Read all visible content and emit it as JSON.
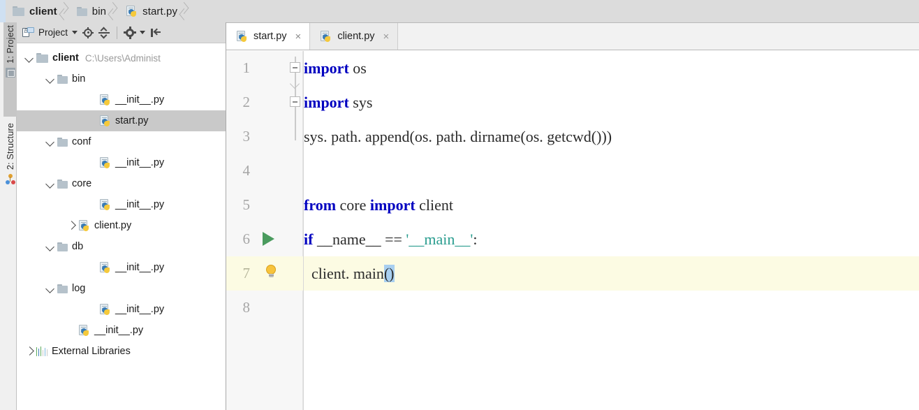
{
  "breadcrumb": {
    "items": [
      {
        "label": "client",
        "icon": "folder-icon",
        "bold": true
      },
      {
        "label": "bin",
        "icon": "folder-icon",
        "bold": false
      },
      {
        "label": "start.py",
        "icon": "python-file-icon",
        "bold": false
      }
    ]
  },
  "tool_strip": {
    "tabs": [
      {
        "label": "1: Project",
        "icon": "project-window-icon",
        "active": true
      },
      {
        "label": "2: Structure",
        "icon": "structure-window-icon",
        "active": false
      }
    ]
  },
  "project_panel": {
    "toolbar": {
      "view_label": "Project",
      "view_icon": "project-view-icon",
      "dropdown_icon": "chevron-down-icon",
      "locate_icon": "scroll-from-source-icon",
      "collapse_icon": "collapse-all-icon",
      "settings_icon": "gear-icon",
      "settings_dropdown_icon": "chevron-down-icon",
      "hide_icon": "hide-panel-icon"
    },
    "tree": [
      {
        "label": "client",
        "path": "C:\\Users\\Administ",
        "icon": "folder-icon",
        "twisty": "down",
        "indent": 0,
        "bold": true,
        "selected": false
      },
      {
        "label": "bin",
        "path": "",
        "icon": "folder-icon",
        "twisty": "down",
        "indent": 1,
        "bold": false,
        "selected": false
      },
      {
        "label": "__init__.py",
        "path": "",
        "icon": "python-file-icon",
        "twisty": "none",
        "indent": 3,
        "bold": false,
        "selected": false
      },
      {
        "label": "start.py",
        "path": "",
        "icon": "python-file-icon",
        "twisty": "none",
        "indent": 3,
        "bold": false,
        "selected": true
      },
      {
        "label": "conf",
        "path": "",
        "icon": "folder-icon",
        "twisty": "down",
        "indent": 1,
        "bold": false,
        "selected": false
      },
      {
        "label": "__init__.py",
        "path": "",
        "icon": "python-file-icon",
        "twisty": "none",
        "indent": 3,
        "bold": false,
        "selected": false
      },
      {
        "label": "core",
        "path": "",
        "icon": "folder-icon",
        "twisty": "down",
        "indent": 1,
        "bold": false,
        "selected": false
      },
      {
        "label": "__init__.py",
        "path": "",
        "icon": "python-file-icon",
        "twisty": "none",
        "indent": 3,
        "bold": false,
        "selected": false
      },
      {
        "label": "client.py",
        "path": "",
        "icon": "python-file-icon",
        "twisty": "right",
        "indent": 2,
        "bold": false,
        "selected": false
      },
      {
        "label": "db",
        "path": "",
        "icon": "folder-icon",
        "twisty": "down",
        "indent": 1,
        "bold": false,
        "selected": false
      },
      {
        "label": "__init__.py",
        "path": "",
        "icon": "python-file-icon",
        "twisty": "none",
        "indent": 3,
        "bold": false,
        "selected": false
      },
      {
        "label": "log",
        "path": "",
        "icon": "folder-icon",
        "twisty": "down",
        "indent": 1,
        "bold": false,
        "selected": false
      },
      {
        "label": "__init__.py",
        "path": "",
        "icon": "python-file-icon",
        "twisty": "none",
        "indent": 3,
        "bold": false,
        "selected": false
      },
      {
        "label": "__init__.py",
        "path": "",
        "icon": "python-file-icon",
        "twisty": "none",
        "indent": 2,
        "bold": false,
        "selected": false
      },
      {
        "label": "External Libraries",
        "path": "",
        "icon": "library-icon",
        "twisty": "right",
        "indent": 0,
        "bold": false,
        "selected": false
      }
    ]
  },
  "editor": {
    "tabs": [
      {
        "label": "start.py",
        "icon": "python-file-icon",
        "close_icon": "close-icon",
        "active": true
      },
      {
        "label": "client.py",
        "icon": "python-file-icon",
        "close_icon": "close-icon",
        "active": false
      }
    ],
    "lines": [
      {
        "number": "1",
        "marker": "fold-minus-icon",
        "current": false,
        "tokens": [
          {
            "t": "import",
            "c": "kw"
          },
          {
            "t": " os",
            "c": "plain"
          }
        ]
      },
      {
        "number": "2",
        "marker": "fold-minus-icon",
        "current": false,
        "tokens": [
          {
            "t": "import",
            "c": "kw"
          },
          {
            "t": " sys",
            "c": "plain"
          }
        ]
      },
      {
        "number": "3",
        "marker": "none",
        "current": false,
        "tokens": [
          {
            "t": "sys. path. append(os. path. dirname(os. getcwd()))",
            "c": "plain"
          }
        ]
      },
      {
        "number": "4",
        "marker": "none",
        "current": false,
        "tokens": [
          {
            "t": "",
            "c": "plain"
          }
        ]
      },
      {
        "number": "5",
        "marker": "none",
        "current": false,
        "tokens": [
          {
            "t": "from",
            "c": "kw"
          },
          {
            "t": " core ",
            "c": "plain"
          },
          {
            "t": "import",
            "c": "kw"
          },
          {
            "t": " client",
            "c": "plain"
          }
        ]
      },
      {
        "number": "6",
        "marker": "run-arrow-icon",
        "current": false,
        "tokens": [
          {
            "t": "if",
            "c": "kw"
          },
          {
            "t": " __name__ == ",
            "c": "plain"
          },
          {
            "t": "'__main__'",
            "c": "str"
          },
          {
            "t": ":",
            "c": "plain"
          }
        ]
      },
      {
        "number": "7",
        "marker": "intention-bulb-icon",
        "current": true,
        "tokens": [
          {
            "t": "  client. main",
            "c": "plain"
          },
          {
            "t": "()",
            "c": "plain sel"
          }
        ]
      },
      {
        "number": "8",
        "marker": "none",
        "current": false,
        "tokens": [
          {
            "t": "",
            "c": "plain"
          }
        ]
      }
    ]
  },
  "colors": {
    "keyword": "#0000c0",
    "string": "#2a9d8f",
    "run_arrow": "#4a9b5e",
    "current_line": "#fcfbe3",
    "selection": "#a8cff0",
    "tree_selected": "#c9c9c9",
    "chrome": "#dcdcdc"
  }
}
